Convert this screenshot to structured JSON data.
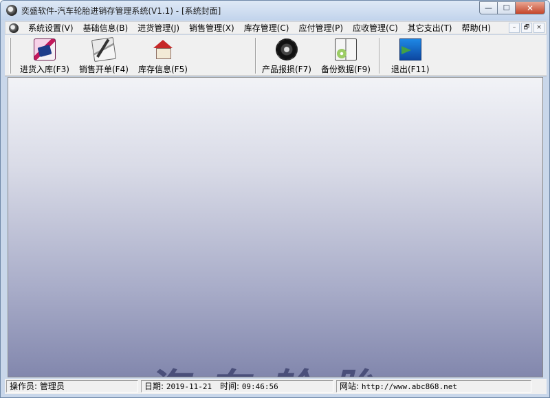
{
  "window": {
    "title": "奕盛软件-汽车轮胎进销存管理系统(V1.1) - [系统封面]",
    "controls": {
      "minimize": "—",
      "maximize": "☐",
      "close": "✕"
    },
    "mdi_controls": {
      "minimize": "–",
      "restore": "🗗",
      "close": "×"
    }
  },
  "menu": {
    "items": [
      "系统设置(V)",
      "基础信息(B)",
      "进货管理(J)",
      "销售管理(X)",
      "库存管理(C)",
      "应付管理(P)",
      "应收管理(C)",
      "其它支出(T)",
      "帮助(H)"
    ]
  },
  "toolbar": {
    "buttons": [
      {
        "label": "进货入库(F3)",
        "icon": "stock-in-icon"
      },
      {
        "label": "销售开单(F4)",
        "icon": "sales-order-icon"
      },
      {
        "label": "库存信息(F5)",
        "icon": "inventory-icon"
      },
      {
        "label": "产品报损(F7)",
        "icon": "tire-scrap-icon"
      },
      {
        "label": "备份数据(F9)",
        "icon": "backup-icon"
      },
      {
        "label": "退出(F11)",
        "icon": "exit-icon"
      }
    ]
  },
  "cover": {
    "banner_text": "汽车轮胎"
  },
  "status": {
    "operator_label": "操作员:",
    "operator": "管理员",
    "date_label": "日期:",
    "date": "2019-11-21",
    "time_label": "时间:",
    "time": "09:46:56",
    "site_label": "网站:",
    "site": "http://www.abc868.net"
  }
}
